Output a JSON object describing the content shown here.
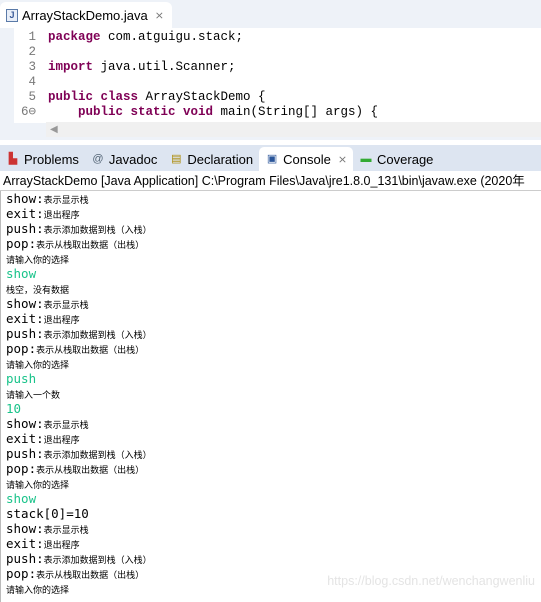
{
  "editor": {
    "tab_label": "ArrayStackDemo.java",
    "close_glyph": "⨯",
    "lines": [
      {
        "n": "1",
        "kw": "package",
        "rest": " com.atguigu.stack;"
      },
      {
        "n": "2",
        "kw": "",
        "rest": ""
      },
      {
        "n": "3",
        "kw": "import",
        "rest": " java.util.Scanner;"
      },
      {
        "n": "4",
        "kw": "",
        "rest": ""
      },
      {
        "n": "5",
        "kw": "public class",
        "rest": " ArrayStackDemo {"
      },
      {
        "n": "6⊖",
        "kw": "    public static void",
        "rest": " main(String[] args) {"
      }
    ]
  },
  "views": {
    "tabs": [
      "Problems",
      "Javadoc",
      "Declaration",
      "Console",
      "Coverage"
    ],
    "active": "Console"
  },
  "console": {
    "header": "ArrayStackDemo [Java Application] C:\\Program Files\\Java\\jre1.8.0_131\\bin\\javaw.exe (2020年",
    "input_color": "#19c38a",
    "lines": [
      {
        "cmd": "show:",
        "desc": "表示显示栈"
      },
      {
        "cmd": "exit:",
        "desc": "退出程序"
      },
      {
        "cmd": "push:",
        "desc": "表示添加数据到栈（入栈）"
      },
      {
        "cmd": "pop:",
        "desc": "表示从栈取出数据（出栈）"
      },
      {
        "cmd": "",
        "desc": "请输入你的选择"
      },
      {
        "cmd": "show",
        "desc": "",
        "input": true
      },
      {
        "cmd": "",
        "desc": "栈空，没有数据"
      },
      {
        "cmd": "show:",
        "desc": "表示显示栈"
      },
      {
        "cmd": "exit:",
        "desc": "退出程序"
      },
      {
        "cmd": "push:",
        "desc": "表示添加数据到栈（入栈）"
      },
      {
        "cmd": "pop:",
        "desc": "表示从栈取出数据（出栈）"
      },
      {
        "cmd": "",
        "desc": "请输入你的选择"
      },
      {
        "cmd": "push",
        "desc": "",
        "input": true
      },
      {
        "cmd": "",
        "desc": "请输入一个数"
      },
      {
        "cmd": "10",
        "desc": "",
        "input": true
      },
      {
        "cmd": "show:",
        "desc": "表示显示栈"
      },
      {
        "cmd": "exit:",
        "desc": "退出程序"
      },
      {
        "cmd": "push:",
        "desc": "表示添加数据到栈（入栈）"
      },
      {
        "cmd": "pop:",
        "desc": "表示从栈取出数据（出栈）"
      },
      {
        "cmd": "",
        "desc": "请输入你的选择"
      },
      {
        "cmd": "show",
        "desc": "",
        "input": true
      },
      {
        "cmd": "stack[0]=10",
        "desc": ""
      },
      {
        "cmd": "show:",
        "desc": "表示显示栈"
      },
      {
        "cmd": "exit:",
        "desc": "退出程序"
      },
      {
        "cmd": "push:",
        "desc": "表示添加数据到栈（入栈）"
      },
      {
        "cmd": "pop:",
        "desc": "表示从栈取出数据（出栈）"
      },
      {
        "cmd": "",
        "desc": "请输入你的选择"
      }
    ]
  },
  "watermark": "https://blog.csdn.net/wenchangwenliu"
}
